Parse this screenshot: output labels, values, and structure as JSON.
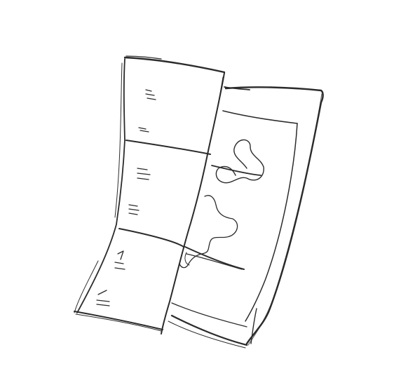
{
  "sketch": {
    "subject": "folded-map-icon",
    "stroke_color": "#2b2b2b",
    "background_color": "#ffffff"
  }
}
